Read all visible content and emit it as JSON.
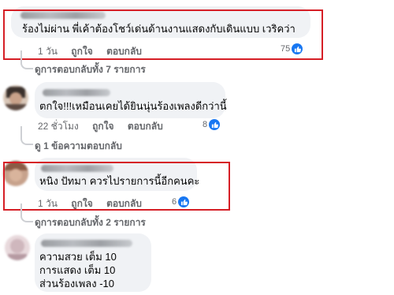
{
  "comments": [
    {
      "text": "ร้องไม่ผ่าน พี่เค้าต้องโชว์เด่นด้านงานแสดงกับเดินแบบ เวริคว่า",
      "time": "1 วัน",
      "like_label": "ถูกใจ",
      "reply_label": "ตอบกลับ",
      "reaction_count": "75",
      "replies_link": "ดูการตอบกลับทั้ง 7 รายการ"
    },
    {
      "text": "ตกใจ!!!เหมือนเคยได้ยินนุ่นร้องเพลงดีกว่านี้",
      "time": "22 ชั่วโมง",
      "like_label": "ถูกใจ",
      "reply_label": "ตอบกลับ",
      "reaction_count": "8",
      "replies_link": "ดู 1 ข้อความตอบกลับ"
    },
    {
      "text": "หนิง ปัทมา ควรไปรายการนี้อีกคนคะ",
      "time": "1 วัน",
      "like_label": "ถูกใจ",
      "reply_label": "ตอบกลับ",
      "reaction_count": "6",
      "replies_link": "ดูการตอบกลับทั้ง 2 รายการ"
    },
    {
      "lines": [
        "ความสวย เต็ม 10",
        "การแสดง เต็ม 10",
        "ส่วนร้องเพลง -10"
      ]
    }
  ],
  "colors": {
    "highlight": "#d61f26",
    "bubble": "#f0f2f5",
    "like": "#1877f2",
    "meta": "#65676b"
  },
  "icons": {
    "reaction": "like-thumb-icon"
  }
}
